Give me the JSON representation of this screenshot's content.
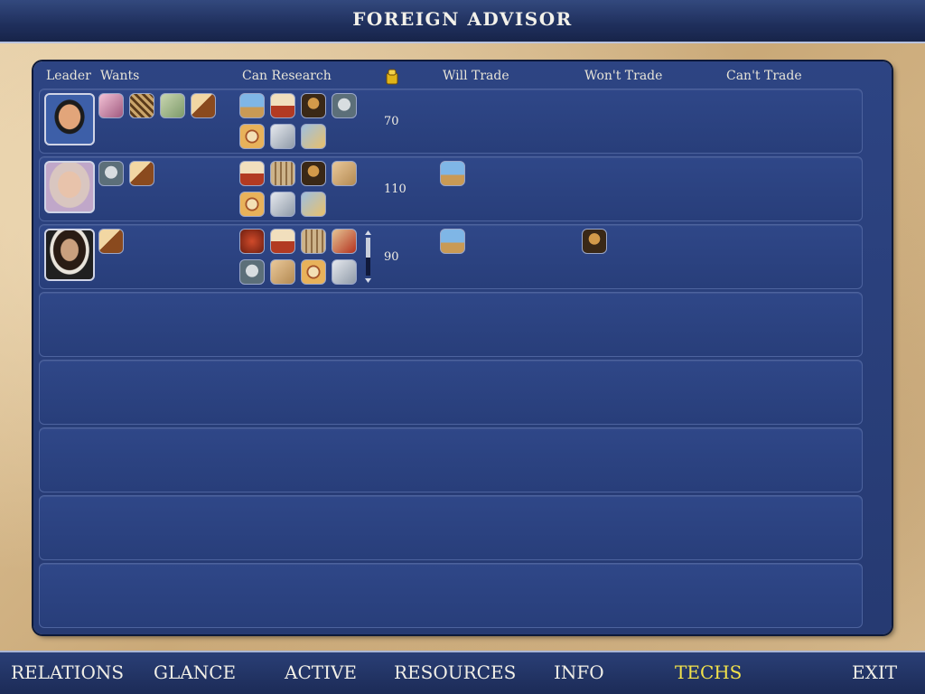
{
  "window": {
    "title": "FOREIGN ADVISOR"
  },
  "columns": {
    "leader": "Leader",
    "wants": "Wants",
    "can_research": "Can Research",
    "gold": "gold-coin-icon",
    "will_trade": "Will Trade",
    "wont_trade": "Won't Trade",
    "cant_trade": "Can't Trade"
  },
  "rows": [
    {
      "leader": "chinese-leader",
      "wants": [
        "tech-icon-pink-scroll",
        "tech-icon-lattice",
        "tech-icon-currency",
        "tech-icon-horse"
      ],
      "can_research": [
        "tech-icon-pyramid",
        "tech-icon-scroll-seal",
        "tech-icon-monalisa",
        "tech-icon-statue",
        "tech-icon-compass",
        "tech-icon-wheel",
        "tech-icon-gears"
      ],
      "gold": "70",
      "will_trade": [],
      "wont_trade": [],
      "cant_trade": []
    },
    {
      "leader": "roman-leader",
      "wants": [
        "tech-icon-bronze-statue",
        "tech-icon-horse"
      ],
      "can_research": [
        "tech-icon-scroll-seal",
        "tech-icon-parchment",
        "tech-icon-monalisa",
        "tech-icon-map",
        "tech-icon-compass",
        "tech-icon-wheel",
        "tech-icon-gears"
      ],
      "gold": "110",
      "will_trade": [
        "tech-icon-pyramid"
      ],
      "wont_trade": [],
      "cant_trade": []
    },
    {
      "leader": "spanish-leader",
      "wants": [
        "tech-icon-horse"
      ],
      "can_research": [
        "tech-icon-dragon",
        "tech-icon-scroll-seal",
        "tech-icon-parchment",
        "tech-icon-map-red",
        "tech-icon-statue",
        "tech-icon-map",
        "tech-icon-compass",
        "tech-icon-wheel"
      ],
      "gold": "90",
      "will_trade": [
        "tech-icon-pyramid"
      ],
      "wont_trade": [
        "tech-icon-monalisa"
      ],
      "cant_trade": [],
      "has_scrollbar": true
    }
  ],
  "empty_rows": 5,
  "nav": {
    "items": [
      "RELATIONS",
      "GLANCE",
      "ACTIVE",
      "RESOURCES",
      "INFO",
      "TECHS",
      "EXIT"
    ],
    "active": "TECHS"
  },
  "colors": {
    "panel": "#2d4483",
    "active_nav": "#f2e24a",
    "title_bar": "#1f2f5c"
  }
}
